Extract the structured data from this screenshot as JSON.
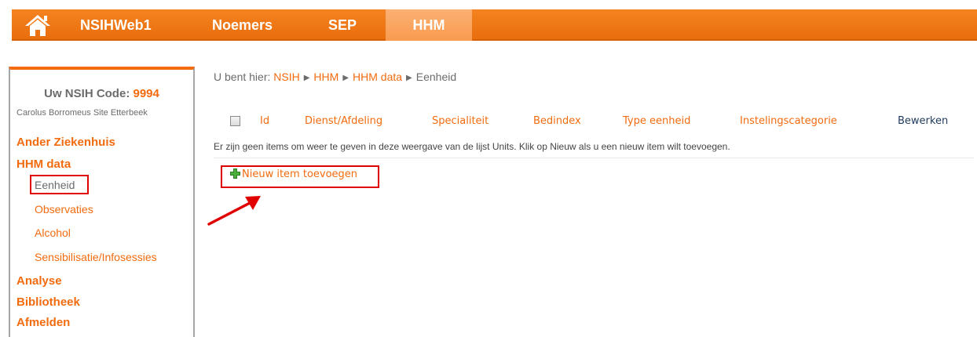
{
  "nav": {
    "home_icon": "home-icon",
    "items": [
      {
        "label": "NSIHWeb1"
      },
      {
        "label": "Noemers"
      },
      {
        "label": "SEP"
      },
      {
        "label": "HHM",
        "active": true
      }
    ]
  },
  "sidebar": {
    "code_label": "Uw NSIH Code:",
    "code_value": "9994",
    "site_name": "Carolus Borromeus Site Etterbeek",
    "items": [
      {
        "label": "Ander Ziekenhuis"
      },
      {
        "label": "HHM data"
      },
      {
        "label": "Eenheid",
        "selected": true
      },
      {
        "label": "Observaties"
      },
      {
        "label": "Alcohol"
      },
      {
        "label": "Sensibilisatie/Infosessies"
      },
      {
        "label": "Analyse"
      },
      {
        "label": "Bibliotheek"
      },
      {
        "label": "Afmelden"
      }
    ]
  },
  "breadcrumb": {
    "prefix": "U bent hier:",
    "items": [
      "NSIH",
      "HHM",
      "HHM data",
      "Eenheid"
    ]
  },
  "list": {
    "columns": [
      "Id",
      "Dienst/Afdeling",
      "Specialiteit",
      "Bedindex",
      "Type eenheid",
      "Instelingscategorie",
      "Bewerken"
    ],
    "empty_message": "Er zijn geen items om weer te geven in deze weergave van de lijst Units. Klik op Nieuw als u een nieuw item wilt toevoegen.",
    "new_item_label": "Nieuw item toevoegen"
  },
  "colors": {
    "accent": "#f26b0f",
    "highlight": "#e00000"
  }
}
